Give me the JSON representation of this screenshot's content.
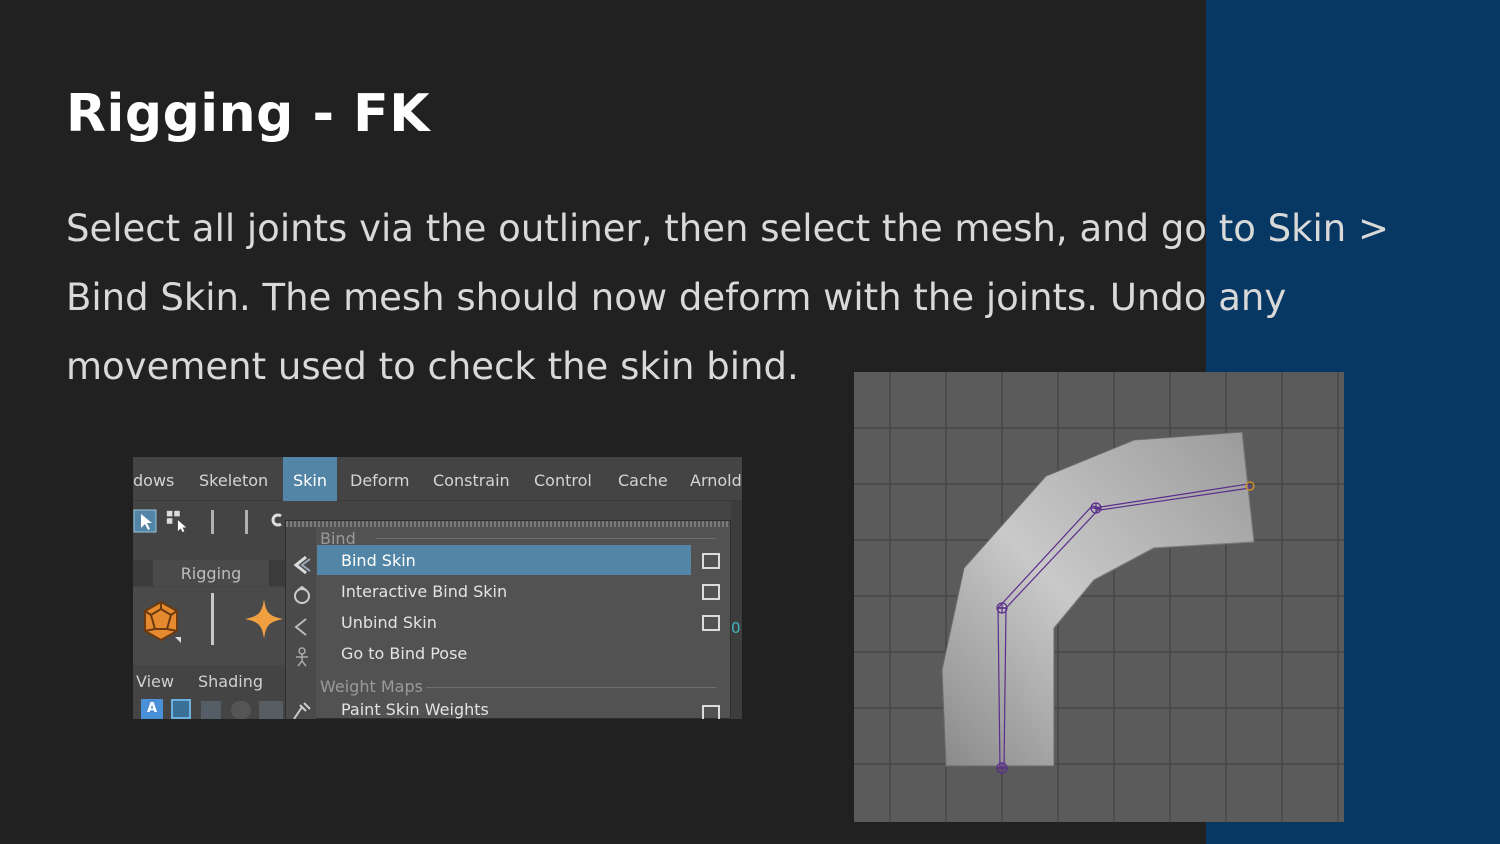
{
  "slide": {
    "title": "Rigging - FK",
    "body": "Select all joints via the outliner, then select the mesh, and go to Skin > Bind Skin. The mesh should now deform with the joints. Undo any movement used to check the skin bind.",
    "accent_color": "#073763",
    "background_color": "#212121"
  },
  "maya_menu": {
    "menubar": [
      "dows",
      "Skeleton",
      "Skin",
      "Deform",
      "Constrain",
      "Control",
      "Cache",
      "Arnold"
    ],
    "active_menu": "Skin",
    "shelf_tab": "Rigging",
    "panel_menu": [
      "View",
      "Shading"
    ],
    "panel_icon_letter": "A",
    "side_glyph": "0",
    "dropdown": {
      "sections": [
        {
          "header": "Bind",
          "items": [
            {
              "label": "Bind Skin",
              "highlighted": true,
              "has_options": true,
              "icon": "bind-skin-icon"
            },
            {
              "label": "Interactive Bind Skin",
              "highlighted": false,
              "has_options": true,
              "icon": "interactive-bind-icon"
            },
            {
              "label": "Unbind Skin",
              "highlighted": false,
              "has_options": true,
              "icon": "unbind-skin-icon"
            },
            {
              "label": "Go to Bind Pose",
              "highlighted": false,
              "has_options": false,
              "icon": "bind-pose-icon"
            }
          ]
        },
        {
          "header": "Weight Maps",
          "items": [
            {
              "label": "Paint Skin Weights",
              "highlighted": false,
              "has_options": true,
              "icon": "paint-weights-icon"
            }
          ]
        }
      ]
    },
    "highlight_color": "#5285a6"
  },
  "viewport": {
    "background_color": "#5b5b5b",
    "grid_color": "#3e3e3e",
    "joint_color": "#5a2d8c",
    "end_joint_color": "#c8902a"
  }
}
